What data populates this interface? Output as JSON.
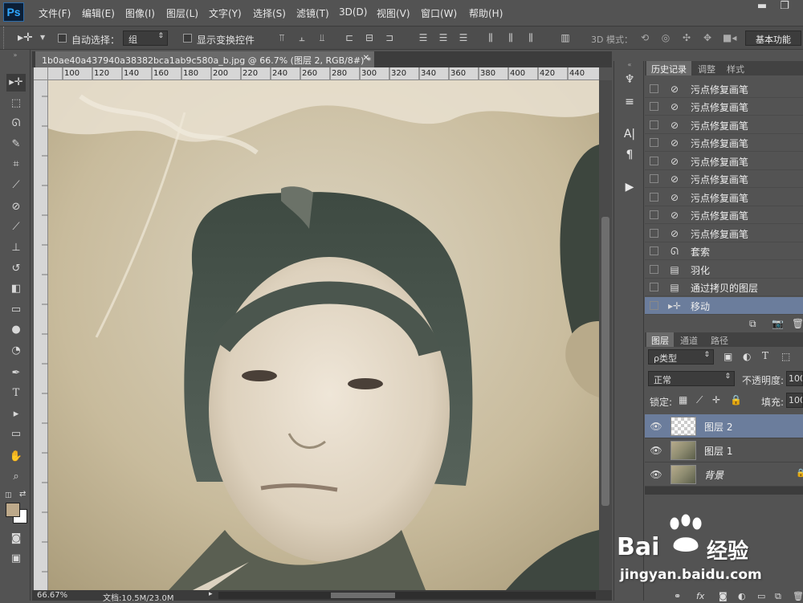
{
  "menubar": {
    "logo": "Ps",
    "items": [
      "文件(F)",
      "编辑(E)",
      "图像(I)",
      "图层(L)",
      "文字(Y)",
      "选择(S)",
      "滤镜(T)",
      "3D(D)",
      "视图(V)",
      "窗口(W)",
      "帮助(H)"
    ]
  },
  "options": {
    "auto_select_label": "自动选择：",
    "auto_select_value": "组",
    "show_transform_label": "显示变换控件",
    "mode_3d_label": "3D 模式：",
    "workspace": "基本功能"
  },
  "document": {
    "tab_title": "1b0ae40a437940a38382bca1ab9c580a_b.jpg @ 66.7% (图层 2, RGB/8#) *",
    "ruler_ticks": [
      "100",
      "120",
      "140",
      "160",
      "180",
      "200",
      "220",
      "240",
      "260",
      "280",
      "300",
      "320",
      "340",
      "360",
      "380",
      "400",
      "420",
      "440"
    ],
    "zoom": "66.67%",
    "doc_size": "文档:10.5M/23.0M"
  },
  "history": {
    "tabs": [
      "历史记录",
      "调整",
      "样式"
    ],
    "items": [
      {
        "icon": "spot-healing-brush-icon",
        "label": "污点修复画笔"
      },
      {
        "icon": "spot-healing-brush-icon",
        "label": "污点修复画笔"
      },
      {
        "icon": "spot-healing-brush-icon",
        "label": "污点修复画笔"
      },
      {
        "icon": "spot-healing-brush-icon",
        "label": "污点修复画笔"
      },
      {
        "icon": "spot-healing-brush-icon",
        "label": "污点修复画笔"
      },
      {
        "icon": "spot-healing-brush-icon",
        "label": "污点修复画笔"
      },
      {
        "icon": "spot-healing-brush-icon",
        "label": "污点修复画笔"
      },
      {
        "icon": "spot-healing-brush-icon",
        "label": "污点修复画笔"
      },
      {
        "icon": "spot-healing-brush-icon",
        "label": "污点修复画笔"
      },
      {
        "icon": "lasso-icon",
        "label": "套索"
      },
      {
        "icon": "document-icon",
        "label": "羽化"
      },
      {
        "icon": "document-icon",
        "label": "通过拷贝的图层"
      },
      {
        "icon": "move-icon",
        "label": "移动"
      }
    ]
  },
  "layers": {
    "tabs": [
      "图层",
      "通道",
      "路径"
    ],
    "filter_label": "ρ类型",
    "blend_mode": "正常",
    "opacity_label": "不透明度:",
    "opacity_value": "100",
    "lock_label": "锁定:",
    "fill_label": "填充:",
    "fill_value": "100",
    "items": [
      {
        "name": "图层 2",
        "thumb": "transparent"
      },
      {
        "name": "图层 1",
        "thumb": "photo"
      },
      {
        "name": "背景",
        "thumb": "photo"
      }
    ]
  },
  "watermark": {
    "text1": "Bai",
    "text2": "经验",
    "url": "jingyan.baidu.com"
  }
}
